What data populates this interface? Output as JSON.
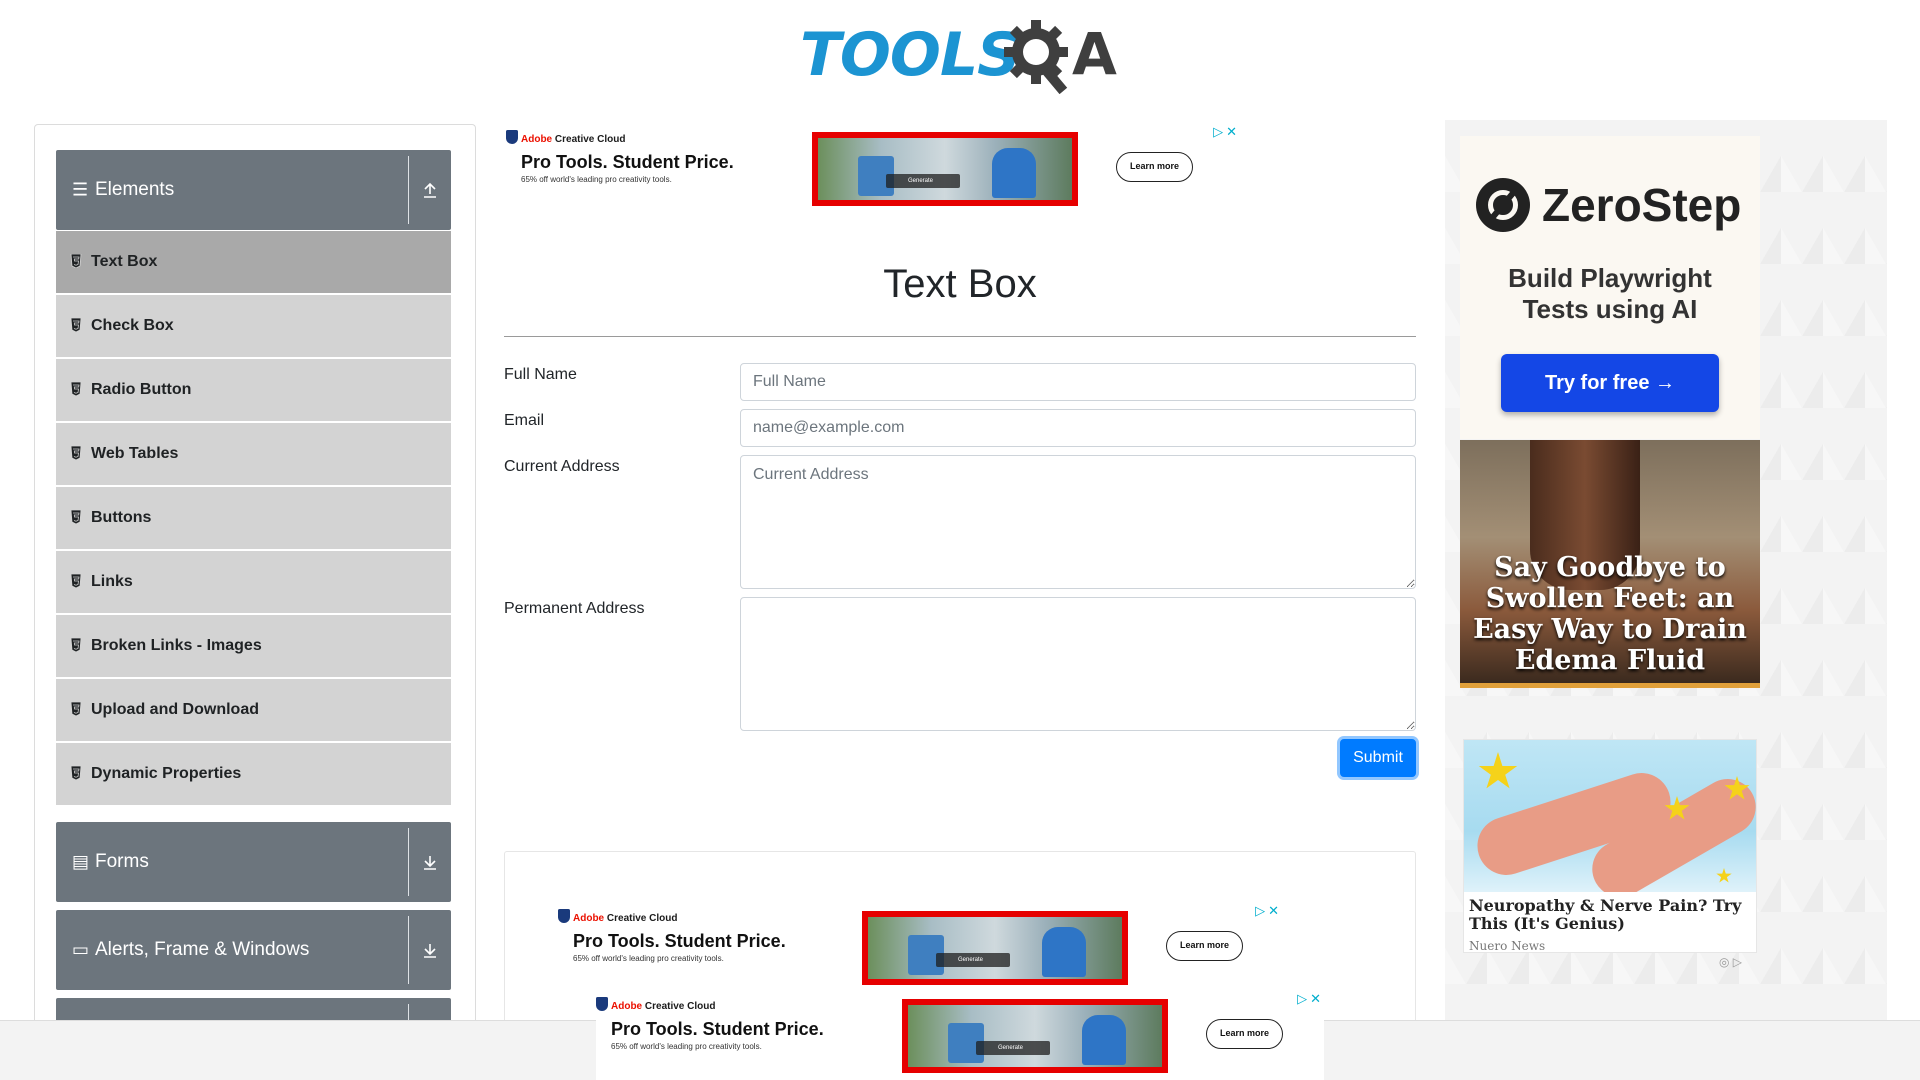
{
  "brand": {
    "logo_text": "TOOLS",
    "logo_q": "Q",
    "logo_a": "A"
  },
  "sidebar": {
    "groups": [
      {
        "label": "Elements",
        "expanded": true
      },
      {
        "label": "Forms"
      },
      {
        "label": "Alerts, Frame & Windows"
      }
    ],
    "items": [
      {
        "label": "Text Box",
        "active": true
      },
      {
        "label": "Check Box"
      },
      {
        "label": "Radio Button"
      },
      {
        "label": "Web Tables"
      },
      {
        "label": "Buttons"
      },
      {
        "label": "Links"
      },
      {
        "label": "Broken Links - Images"
      },
      {
        "label": "Upload and Download"
      },
      {
        "label": "Dynamic Properties"
      }
    ]
  },
  "ad_banner": {
    "brand_prefix": "Adobe",
    "brand_suffix": " Creative Cloud",
    "headline": "Pro Tools. Student Price.",
    "subtext": "65% off world's leading pro creativity tools.",
    "image_caption": "Generate",
    "cta": "Learn more"
  },
  "main": {
    "title": "Text Box",
    "fields": {
      "full_name": {
        "label": "Full Name",
        "placeholder": "Full Name",
        "value": ""
      },
      "email": {
        "label": "Email",
        "placeholder": "name@example.com",
        "value": ""
      },
      "current_address": {
        "label": "Current Address",
        "placeholder": "Current Address",
        "value": ""
      },
      "permanent_address": {
        "label": "Permanent Address",
        "placeholder": "",
        "value": ""
      }
    },
    "submit_label": "Submit"
  },
  "right_ads": {
    "zerostep": {
      "name": "ZeroStep",
      "tagline_1": "Build Playwright",
      "tagline_2": "Tests using AI",
      "cta": "Try for free →"
    },
    "edema": {
      "headline": "Say Goodbye to Swollen Feet: an Easy Way to Drain Edema Fluid"
    },
    "neuropathy": {
      "headline": "Neuropathy & Nerve Pain? Try This (It's Genius)",
      "source": "Nuero News"
    }
  },
  "colors": {
    "accent": "#007bff",
    "sidebar_group": "#6c757d",
    "sidebar_item": "#d3d3d3",
    "logo_blue": "#1c94d2"
  }
}
